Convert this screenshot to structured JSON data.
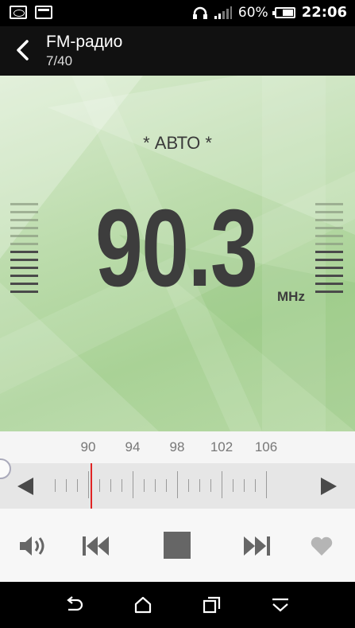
{
  "status_bar": {
    "battery": "60%",
    "battery_level": 0.6,
    "time": "22:06",
    "icons": [
      "sim-icon",
      "image-icon",
      "headphones-icon",
      "signal-icon",
      "battery-icon"
    ]
  },
  "app_bar": {
    "title": "FM-радио",
    "subtitle": "7/40"
  },
  "display": {
    "mode": "* АВТО *",
    "frequency": "90.3",
    "unit": "MHz"
  },
  "scale": {
    "labels": [
      "90",
      "94",
      "98",
      "102",
      "106"
    ]
  },
  "colors": {
    "accent_needle": "#e02424",
    "display_green": "#b6d8a4"
  },
  "controls": [
    "volume-icon",
    "previous-station-icon",
    "stop-icon",
    "next-station-icon",
    "favorite-heart-icon"
  ],
  "nav_bar": [
    "back-icon",
    "home-icon",
    "recents-icon",
    "notifications-icon"
  ]
}
